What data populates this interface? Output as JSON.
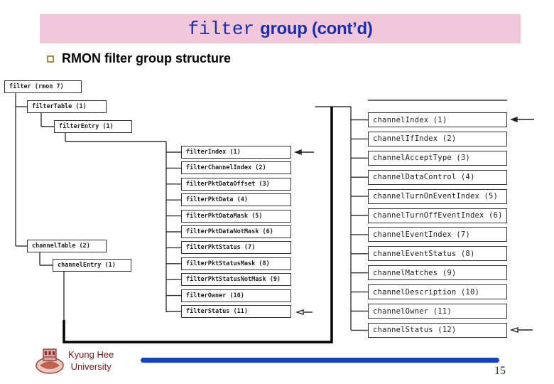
{
  "title": {
    "mono_part": "filter",
    "bold_part": "group (cont’d)"
  },
  "bullet": {
    "icon": "hollow-square-bullet",
    "text": "RMON filter group structure"
  },
  "diagram": {
    "root": "filter (rmon 7)",
    "filter_table": "filterTable (1)",
    "filter_entry": "filterEntry (1)",
    "filter_objects": [
      "filterIndex (1)",
      "filterChannelIndex (2)",
      "filterPktDataOffset (3)",
      "filterPktData (4)",
      "filterPktDataMask (5)",
      "filterPktDataNotMask (6)",
      "filterPktStatus (7)",
      "filterPktStatusMask (8)",
      "filterPktStatusNotMask (9)",
      "filterOwner (10)",
      "filterStatus (11)"
    ],
    "channel_table": "channelTable (2)",
    "channel_entry": "channelEntry (1)",
    "channel_objects": [
      "channelIndex (1)",
      "channelIfIndex (2)",
      "channelAcceptType (3)",
      "channelDataControl (4)",
      "channelTurnOnEventIndex (5)",
      "channelTurnOffEventIndex (6)",
      "channelEventIndex (7)",
      "channelEventStatus (8)",
      "channelMatches (9)",
      "channelDescription (10)",
      "channelOwner (11)",
      "channelStatus (12)"
    ],
    "index_arrows": [
      "filterIndex (1)",
      "channelIndex (1)"
    ],
    "status_arrows": [
      "filterStatus (11)",
      "channelStatus (12)"
    ]
  },
  "footer": {
    "university_line1": "Kyung Hee",
    "university_line2": "University",
    "page_number": "15",
    "bar_color": "#1040d8"
  }
}
